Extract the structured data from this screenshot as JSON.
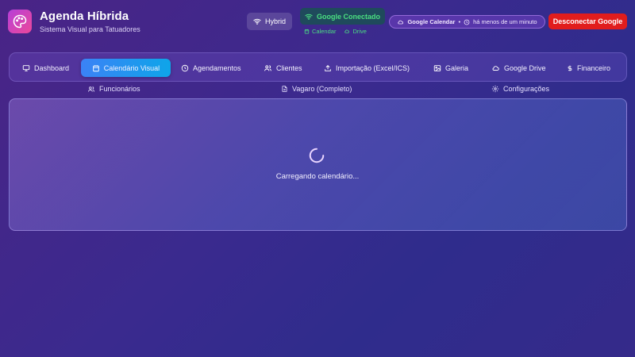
{
  "header": {
    "title": "Agenda Híbrida",
    "subtitle": "Sistema Visual para Tatuadores",
    "logo_icon": "palette-icon",
    "mode_badge": "Hybrid",
    "google_status": "Google Conectado",
    "services": [
      "Calendar",
      "Drive"
    ],
    "sync": {
      "service": "Google Calendar",
      "separator": "•",
      "last_sync": "há menos de um minuto"
    },
    "disconnect_label": "Desconectar Google"
  },
  "nav": {
    "tabs": [
      {
        "label": "Dashboard",
        "icon": "monitor-icon"
      },
      {
        "label": "Calendário Visual",
        "icon": "calendar-icon",
        "active": true
      },
      {
        "label": "Agendamentos",
        "icon": "clock-icon"
      },
      {
        "label": "Clientes",
        "icon": "users-icon"
      },
      {
        "label": "Importação (Excel/ICS)",
        "icon": "upload-icon"
      },
      {
        "label": "Galeria",
        "icon": "image-icon"
      },
      {
        "label": "Google Drive",
        "icon": "cloud-icon"
      },
      {
        "label": "Financeiro",
        "icon": "dollar-icon"
      }
    ],
    "secondary": [
      {
        "label": "Funcionários",
        "icon": "users-icon"
      },
      {
        "label": "Vagaro (Completo)",
        "icon": "file-icon"
      },
      {
        "label": "Configurações",
        "icon": "gear-icon"
      }
    ]
  },
  "main": {
    "loading_text": "Carregando calendário..."
  },
  "colors": {
    "accent": "#3b82f6",
    "connected": "#4ade80",
    "danger": "#e11d1d",
    "logo": "#c846d8"
  }
}
